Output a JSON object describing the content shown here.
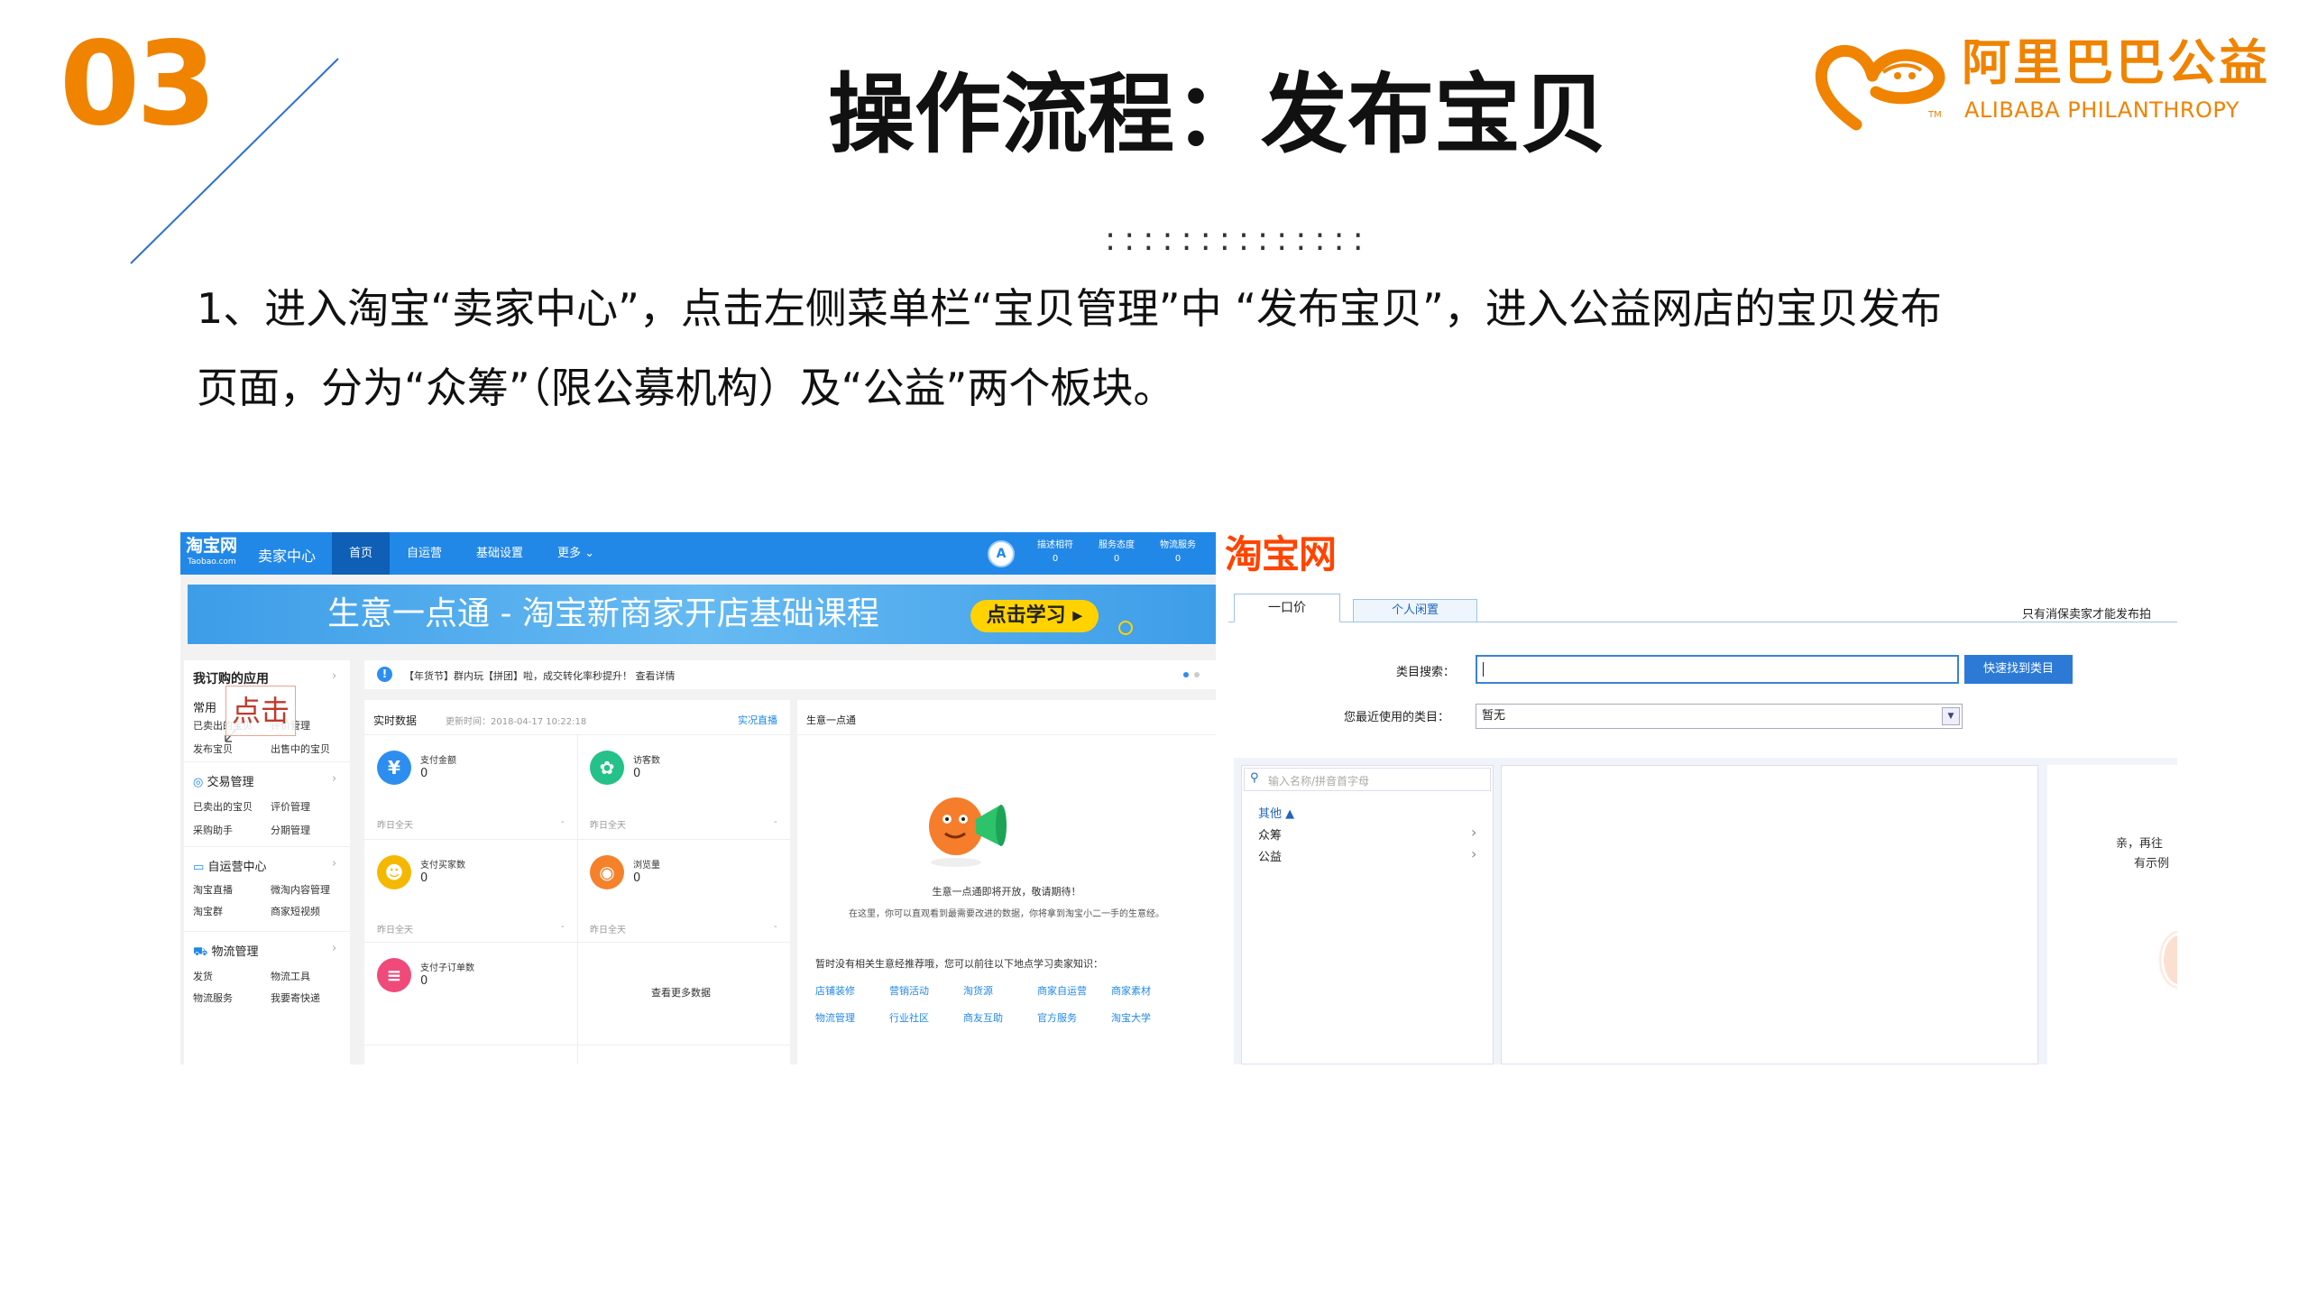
{
  "slide": {
    "number": "03",
    "title": "操作流程：发布宝贝",
    "dots": "::::::::::::::",
    "body_line1": "1、进入淘宝“卖家中心”，点击左侧菜单栏“宝贝管理”中 “发布宝贝”，进入公益网店的宝贝发布",
    "body_line2": "页面，分为“众筹”（限公募机构）及“公益”两个板块。",
    "logo_cn": "阿里巴巴公益",
    "logo_en": "ALIBABA PHILANTHROPY",
    "logo_tm": "TM"
  },
  "seller_center": {
    "logo": "淘宝网",
    "logo_sub": "Taobao.com",
    "center_label": "卖家中心",
    "nav": [
      "首页",
      "自运营",
      "基础设置",
      "更多 ⌄"
    ],
    "avatar_letter": "A",
    "stats": [
      {
        "label": "描述相符",
        "value": "0"
      },
      {
        "label": "服务态度",
        "value": "0"
      },
      {
        "label": "物流服务",
        "value": "0"
      }
    ],
    "banner_text": "生意一点通 - 淘宝新商家开店基础课程",
    "banner_button": "点击学习 ▸",
    "sidebar": {
      "subscribed_title": "我订购的应用",
      "common_label": "常用",
      "common_items": [
        "已卖出的宝贝",
        "评价管理",
        "发布宝贝",
        "出售中的宝贝"
      ],
      "callout": "点击",
      "groups": [
        {
          "title": "交易管理",
          "items": [
            "已卖出的宝贝",
            "评价管理",
            "采购助手",
            "分期管理"
          ]
        },
        {
          "title": "自运营中心",
          "items": [
            "淘宝直播",
            "微淘内容管理",
            "淘宝群",
            "商家短视频"
          ]
        },
        {
          "title": "物流管理",
          "items": [
            "发货",
            "物流工具",
            "物流服务",
            "我要寄快递"
          ]
        }
      ]
    },
    "notice": "【年货节】群内玩【拼团】啦，成交转化率秒提升！ 查看详情",
    "realtime": {
      "title": "实时数据",
      "update_time": "更新时间：2018-04-17 10:22:18",
      "live_link": "实况直播",
      "metrics": [
        {
          "label": "支付金额",
          "value": "0",
          "footer": "昨日全天",
          "dash": "-",
          "color": "#2d8ef0",
          "glyph": "¥"
        },
        {
          "label": "访客数",
          "value": "0",
          "footer": "昨日全天",
          "dash": "-",
          "color": "#24c18a",
          "glyph": "✿"
        },
        {
          "label": "支付买家数",
          "value": "0",
          "footer": "昨日全天",
          "dash": "-",
          "color": "#f5b800",
          "glyph": "☻"
        },
        {
          "label": "浏览量",
          "value": "0",
          "footer": "昨日全天",
          "dash": "-",
          "color": "#f5822a",
          "glyph": "◉"
        },
        {
          "label": "支付子订单数",
          "value": "0",
          "color": "#ef4a7a",
          "glyph": "≡"
        }
      ],
      "more_data": "查看更多数据"
    },
    "yidiantong": {
      "title": "生意一点通",
      "coming": "生意一点通即将开放，敬请期待！",
      "desc": "在这里，你可以直观看到最需要改进的数据，你将拿到淘宝小二一手的生意经。",
      "hint": "暂时没有相关生意经推荐哦，您可以前往以下地点学习卖家知识：",
      "links_row1": [
        "店铺装修",
        "营销活动",
        "淘货源",
        "商家自运营",
        "商家素材"
      ],
      "links_row2": [
        "物流管理",
        "行业社区",
        "商友互助",
        "官方服务",
        "淘宝大学"
      ]
    }
  },
  "publish_page": {
    "logo": "淘宝网",
    "tab_active": "一口价",
    "tab_other": "个人闲置",
    "note": "只有消保卖家才能发布拍",
    "search_label": "类目搜索：",
    "search_button": "快速找到类目",
    "recent_label": "您最近使用的类目：",
    "recent_value": "暂无",
    "filter_placeholder": "输入名称/拼音首字母",
    "categories": [
      {
        "name": "其他 ▲",
        "chevron": ""
      },
      {
        "name": "众筹",
        "chevron": "›"
      },
      {
        "name": "公益",
        "chevron": "›"
      }
    ],
    "side_line1": "亲，再往",
    "side_line2": "有示例"
  }
}
